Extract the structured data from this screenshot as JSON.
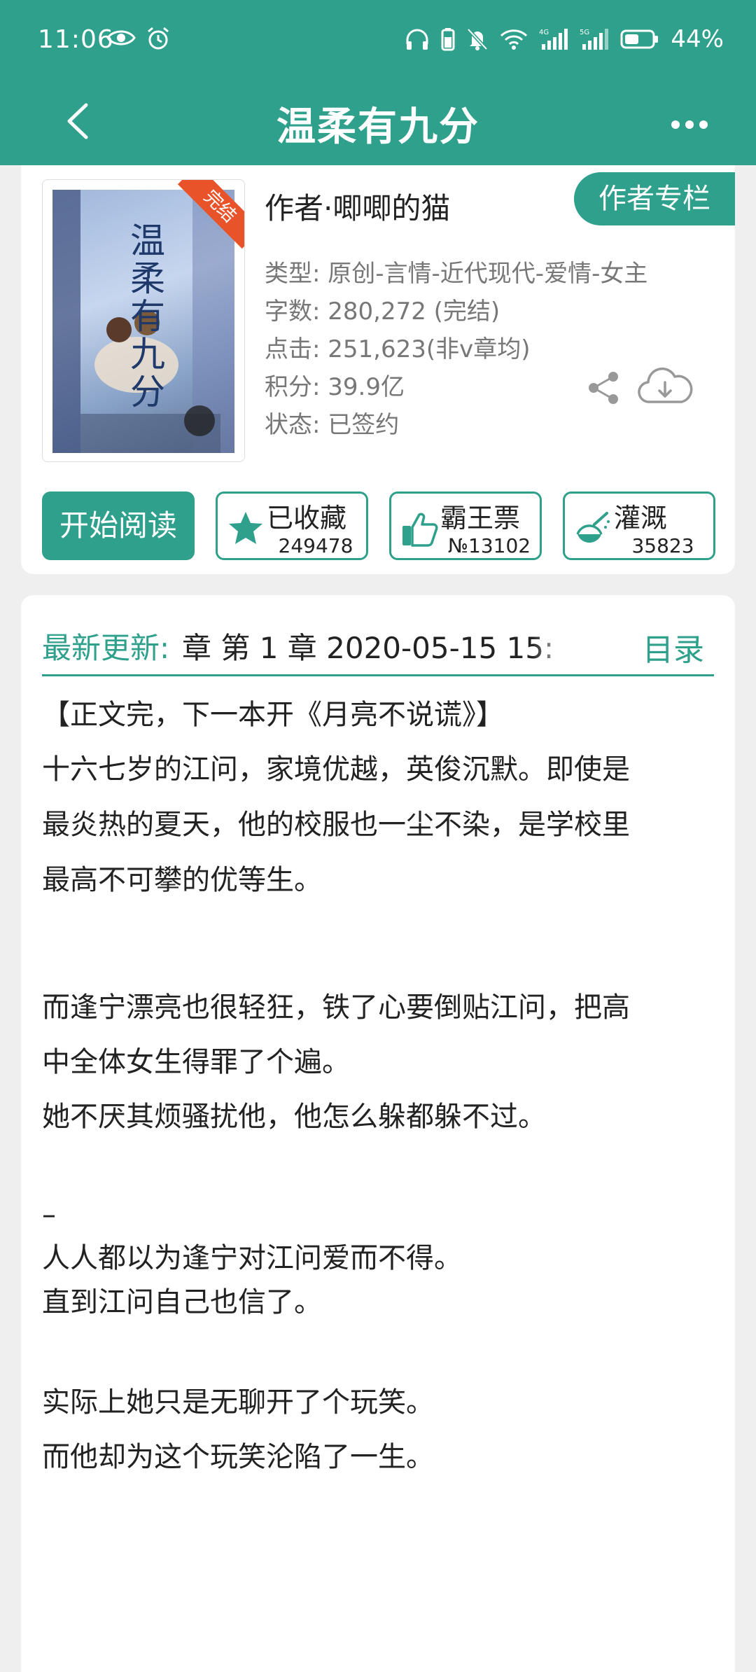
{
  "status_bar": {
    "time": "11:06",
    "battery": "44%"
  },
  "app_bar": {
    "title": "温柔有九分"
  },
  "book": {
    "cover_badge": "完结",
    "cover_title": "温柔有九分",
    "author_line": "作者·唧唧的猫",
    "author_column_label": "作者专栏",
    "meta": [
      "类型: 原创-言情-近代现代-爱情-女主",
      "字数: 280,272 (完结)",
      "点击: 251,623(非v章均)",
      "积分: 39.9亿",
      "状态: 已签约"
    ]
  },
  "actions": {
    "read_label": "开始阅读",
    "collect": {
      "label": "已收藏",
      "count": "249478"
    },
    "ticket": {
      "label": "霸王票",
      "count": "№13102"
    },
    "water": {
      "label": "灌溉",
      "count": "35823"
    }
  },
  "update": {
    "label": "最新更新:",
    "text": "章  第 1 章  2020-05-15 15:",
    "toc_label": "目录"
  },
  "description": [
    "【正文完，下一本开《月亮不说谎》】",
    "十六七岁的江问，家境优越，英俊沉默。即使是",
    "最炎热的夏天，他的校服也一尘不染，是学校里",
    "最高不可攀的优等生。",
    "",
    "而逢宁漂亮也很轻狂，铁了心要倒贴江问，把高",
    "中全体女生得罪了个遍。",
    "她不厌其烦骚扰他，他怎么躲都躲不过。",
    "",
    "–",
    "人人都以为逢宁对江问爱而不得。",
    "直到江问自己也信了。",
    "",
    "实际上她只是无聊开了个玩笑。",
    "而他却为这个玩笑沦陷了一生。"
  ],
  "colors": {
    "accent": "#2ea08b",
    "badge": "#e8532a"
  }
}
